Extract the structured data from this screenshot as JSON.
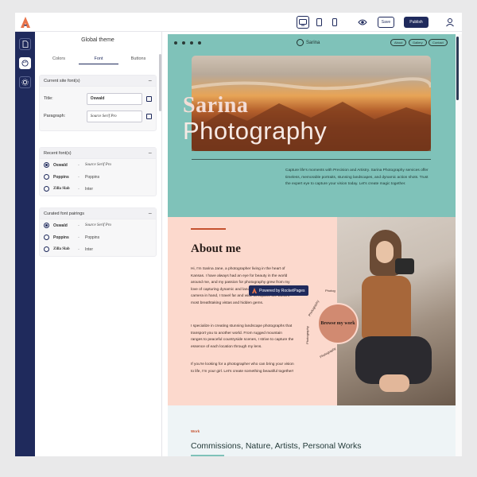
{
  "topbar": {
    "save_label": "Save",
    "publish_label": "Publish"
  },
  "panel": {
    "title": "Global theme",
    "tabs": [
      "Colors",
      "Font",
      "Buttons"
    ],
    "current": {
      "heading": "Current site font(s)",
      "title_label": "Title:",
      "title_value": "Oswald",
      "paragraph_label": "Paragraph:",
      "paragraph_value": "Source Serif Pro"
    },
    "recent": {
      "heading": "Recent font(s)",
      "rows": [
        {
          "a": "Oswald",
          "b": "Source Serif Pro"
        },
        {
          "a": "Poppins",
          "b": "Poppins"
        },
        {
          "a": "Zilla Slab",
          "b": "Inter"
        }
      ]
    },
    "curated": {
      "heading": "Curated font pairings",
      "rows": [
        {
          "a": "Oswald",
          "b": "Source Serif Pro"
        },
        {
          "a": "Poppins",
          "b": "Poppins"
        },
        {
          "a": "Zilla Slab",
          "b": "Inter"
        }
      ]
    },
    "dash": "-"
  },
  "preview": {
    "brand": "Sarina",
    "nav": [
      "About",
      "Gallery",
      "Contact"
    ],
    "hero_title_1": "Sarina",
    "hero_title_2": "Photography",
    "hero_text": "Capture life's moments with Precision and Artistry. Sarina Photography services offer timeless, memorable portraits, stunning landscapes, and dynamic action shots. Trust the expert eye to capture your vision today. Let's create magic together.",
    "about_title": "About me",
    "about_p1": "Hi, I'm Sarina Jane, a photographer living in the heart of Kansas. I have always had an eye for beauty in the world around me, and my passion for photography grew from my love of capturing dynamic and landscape shots. With my camera in hand, I travel far and wide to explore the world's most breathtaking vistas and hidden gems.",
    "about_p2": "I specialize in creating stunning landscape photographs that transport you to another world. From rugged mountain ranges to peaceful countryside scenes, I strive to capture the essence of each location through my lens.",
    "about_p3": "If you're looking for a photographer who can bring your vision to life, I'm your girl. Let's create something beautiful together!",
    "badge": "Browse my work",
    "curve": [
      "Photog",
      "Photography",
      "Photography",
      "Photography"
    ],
    "powered": "Powered by RocketPages",
    "work_kicker": "Work",
    "work_title": "Commissions,  Nature,  Artists,  Personal Works"
  },
  "colors": {
    "navy": "#1f2a5c",
    "teal": "#7fc2b9",
    "peach": "#fcd9cd",
    "accent": "#c5522f"
  }
}
